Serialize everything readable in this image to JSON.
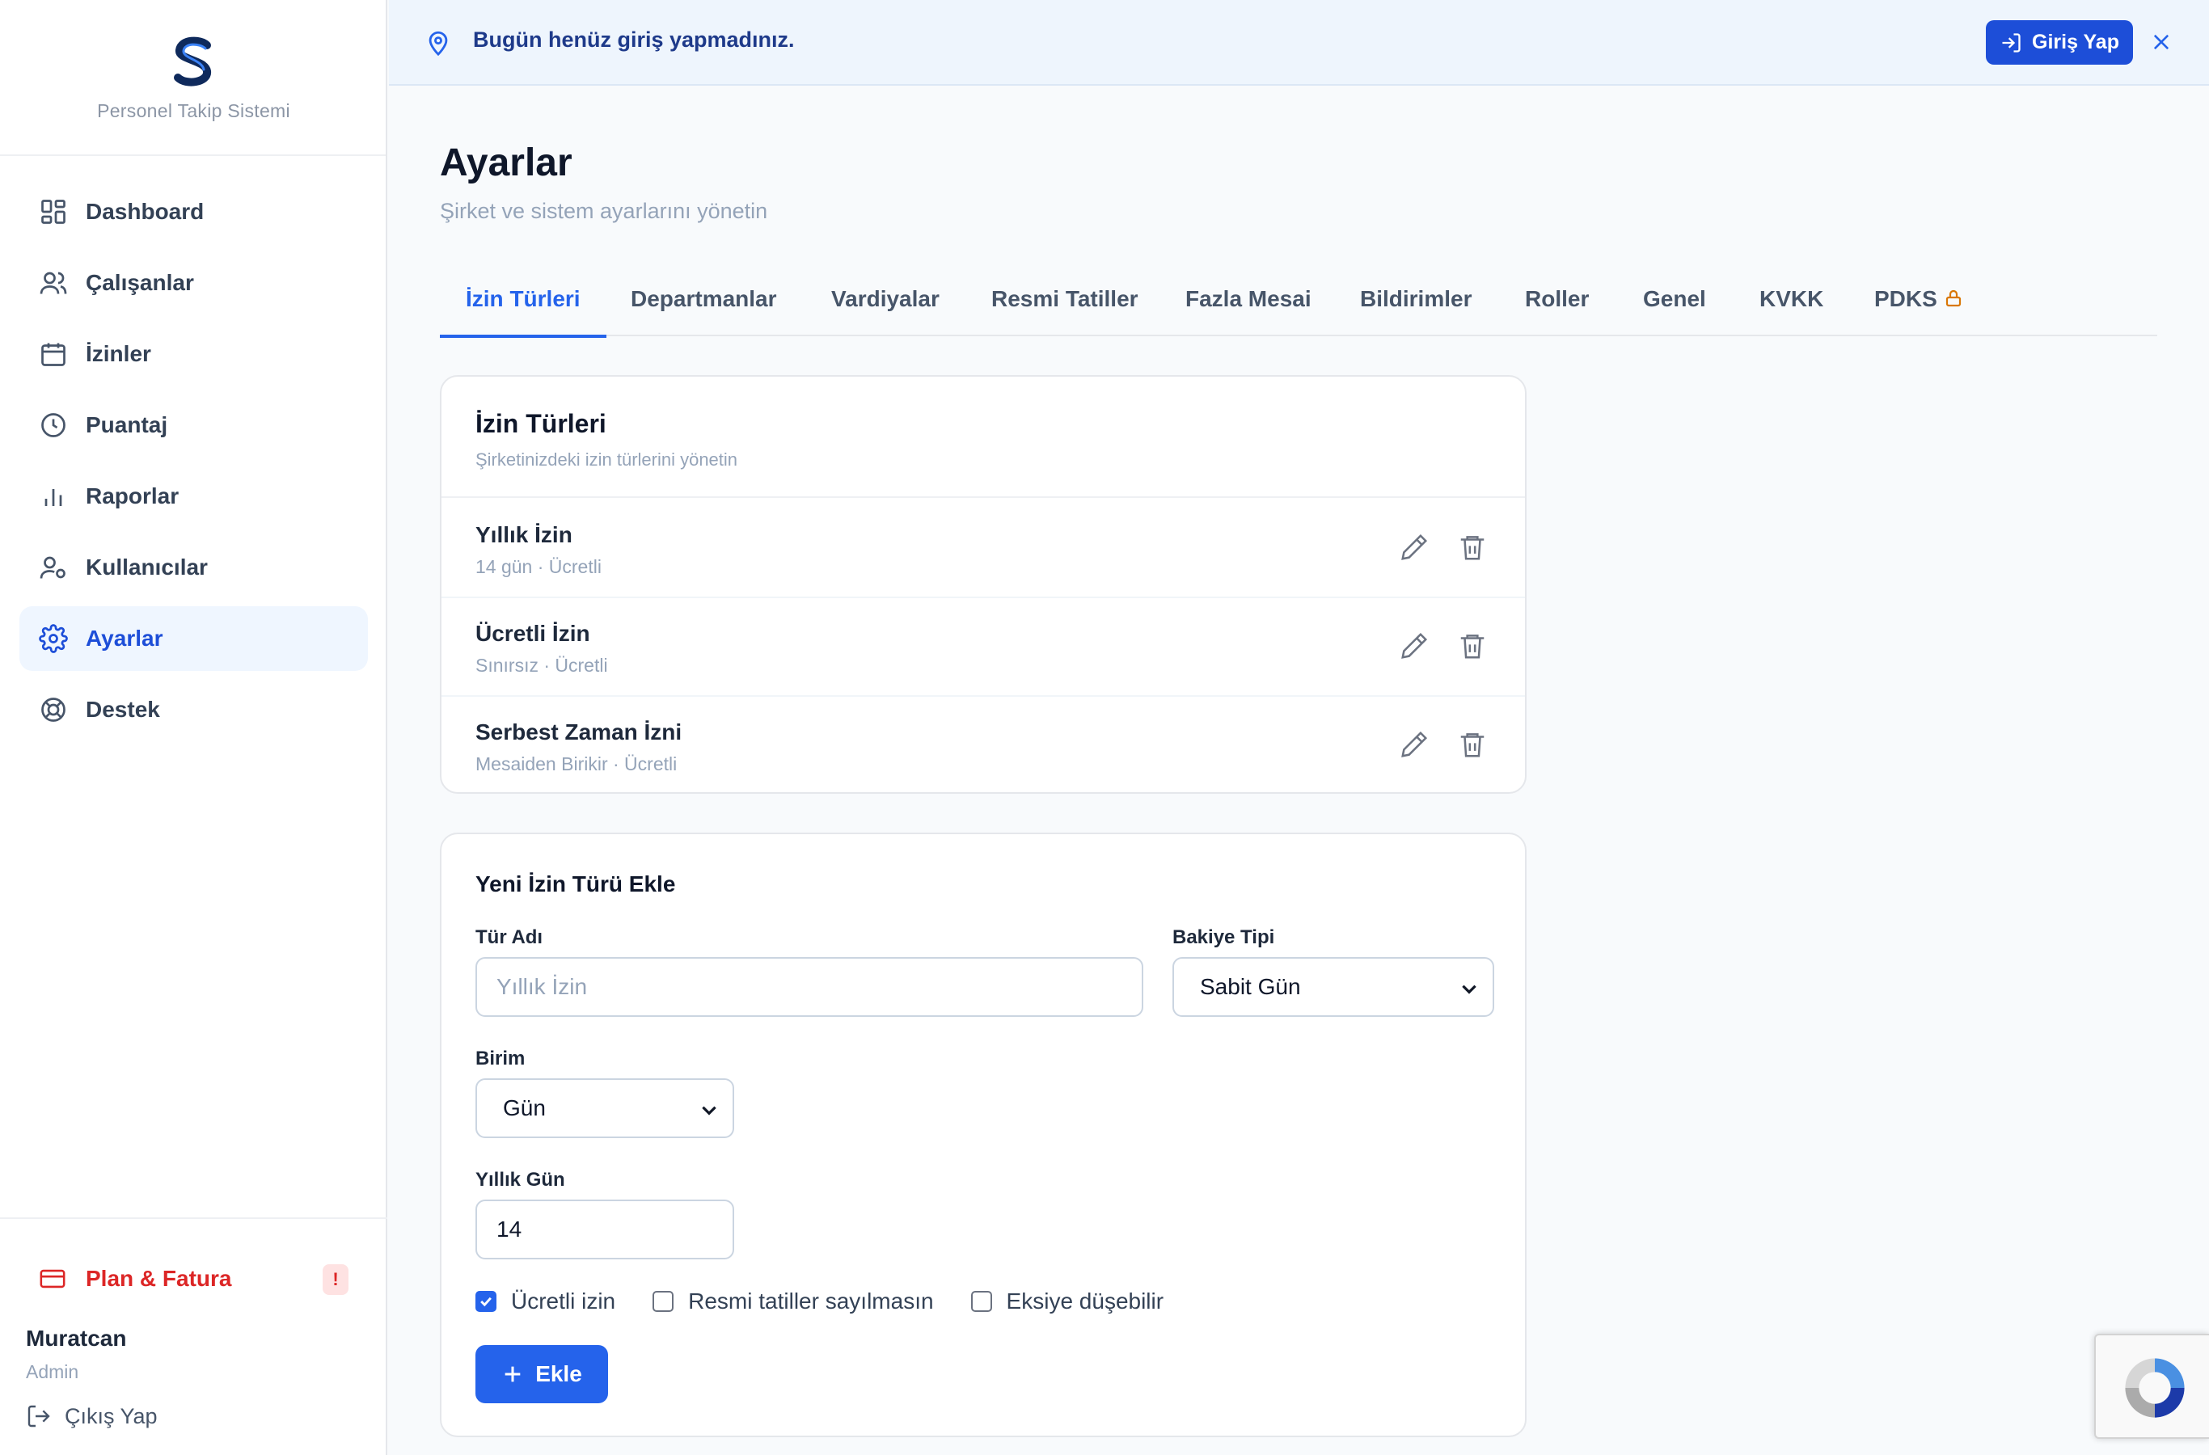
{
  "brand": {
    "name": "Personel Takip Sistemi",
    "logo_letter": "S"
  },
  "sidebar": {
    "items": [
      {
        "label": "Dashboard",
        "icon": "grid-icon",
        "active": false
      },
      {
        "label": "Çalışanlar",
        "icon": "users-icon",
        "active": false
      },
      {
        "label": "İzinler",
        "icon": "calendar-icon",
        "active": false
      },
      {
        "label": "Puantaj",
        "icon": "clock-icon",
        "active": false
      },
      {
        "label": "Raporlar",
        "icon": "bar-chart-icon",
        "active": false
      },
      {
        "label": "Kullanıcılar",
        "icon": "user-cog-icon",
        "active": false
      },
      {
        "label": "Ayarlar",
        "icon": "gear-icon",
        "active": true
      },
      {
        "label": "Destek",
        "icon": "lifebuoy-icon",
        "active": false
      }
    ],
    "plan": {
      "label": "Plan & Fatura",
      "badge": "!",
      "icon": "credit-card-icon"
    },
    "user": {
      "name": "Muratcan",
      "role": "Admin"
    },
    "logout_label": "Çıkış Yap"
  },
  "banner": {
    "message": "Bugün henüz giriş yapmadınız.",
    "login_label": "Giriş Yap"
  },
  "page": {
    "title": "Ayarlar",
    "subtitle": "Şirket ve sistem ayarlarını yönetin"
  },
  "tabs": [
    {
      "label": "İzin Türleri",
      "active": true
    },
    {
      "label": "Departmanlar"
    },
    {
      "label": "Vardiyalar"
    },
    {
      "label": "Resmi Tatiller"
    },
    {
      "label": "Fazla Mesai"
    },
    {
      "label": "Bildirimler"
    },
    {
      "label": "Roller"
    },
    {
      "label": "Genel"
    },
    {
      "label": "KVKK"
    },
    {
      "label": "PDKS",
      "locked": true
    }
  ],
  "leave_types_card": {
    "title": "İzin Türleri",
    "subtitle": "Şirketinizdeki izin türlerini yönetin",
    "items": [
      {
        "name": "Yıllık İzin",
        "meta": "14 gün · Ücretli"
      },
      {
        "name": "Ücretli İzin",
        "meta": "Sınırsız · Ücretli"
      },
      {
        "name": "Serbest Zaman İzni",
        "meta": "Mesaiden Birikir · Ücretli"
      }
    ]
  },
  "new_leave_form": {
    "title": "Yeni İzin Türü Ekle",
    "type_name": {
      "label": "Tür Adı",
      "placeholder": "Yıllık İzin",
      "value": ""
    },
    "balance_type": {
      "label": "Bakiye Tipi",
      "value": "Sabit Gün"
    },
    "unit": {
      "label": "Birim",
      "value": "Gün"
    },
    "annual_days": {
      "label": "Yıllık Gün",
      "value": "14"
    },
    "checkboxes": [
      {
        "label": "Ücretli izin",
        "checked": true
      },
      {
        "label": "Resmi tatiller sayılmasın",
        "checked": false
      },
      {
        "label": "Eksiye düşebilir",
        "checked": false
      }
    ],
    "submit_label": "Ekle"
  },
  "colors": {
    "accent": "#2563eb",
    "danger": "#dc2626",
    "lock": "#d97706"
  }
}
